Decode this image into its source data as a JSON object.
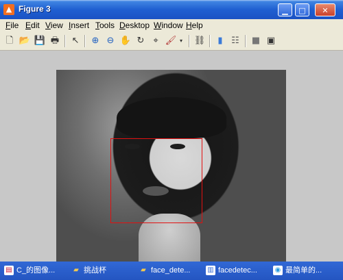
{
  "window": {
    "title": "Figure 3",
    "controls": {
      "minimize": "▁",
      "maximize": "□",
      "close": "✕"
    }
  },
  "menu": [
    {
      "label": "File",
      "ul": "F",
      "rest": "ile"
    },
    {
      "label": "Edit",
      "ul": "E",
      "rest": "dit"
    },
    {
      "label": "View",
      "ul": "V",
      "rest": "iew"
    },
    {
      "label": "Insert",
      "ul": "I",
      "rest": "nsert"
    },
    {
      "label": "Tools",
      "ul": "T",
      "rest": "ools"
    },
    {
      "label": "Desktop",
      "ul": "D",
      "rest": "esktop"
    },
    {
      "label": "Window",
      "ul": "W",
      "rest": "indow"
    },
    {
      "label": "Help",
      "ul": "H",
      "rest": "elp"
    }
  ],
  "toolbar": {
    "icons": [
      "new-figure-icon",
      "open-file-icon",
      "save-icon",
      "print-icon",
      "edit-plot-arrow-icon",
      "zoom-in-icon",
      "zoom-out-icon",
      "pan-hand-icon",
      "rotate-3d-icon",
      "data-cursor-icon",
      "brush-icon",
      "brush-dropdown-icon",
      "link-plot-icon",
      "colorbar-icon",
      "legend-icon",
      "hide-plot-tools-icon",
      "show-plot-tools-icon"
    ]
  },
  "figure": {
    "image_description_icon": "grayscale-photo",
    "detection_box_color": "#e21010"
  },
  "taskbar": {
    "items": [
      {
        "label": "C_的图像...",
        "icon": "pdf-doc-icon",
        "icon_color": "#c8102e"
      },
      {
        "label": "挑战杯",
        "icon": "folder-icon",
        "icon_color": "#f0c850"
      },
      {
        "label": "face_dete...",
        "icon": "folder-icon",
        "icon_color": "#f0c850"
      },
      {
        "label": "facedetec...",
        "icon": "document-icon",
        "icon_color": "#3a6fd8"
      },
      {
        "label": "最简单的...",
        "icon": "browser-doc-icon",
        "icon_color": "#2b9be0"
      }
    ]
  },
  "colors": {
    "titlebar": "#1f5fd1",
    "chrome": "#ece9d8",
    "figure_bg": "#c8c8c8",
    "taskbar": "#2455c1"
  }
}
